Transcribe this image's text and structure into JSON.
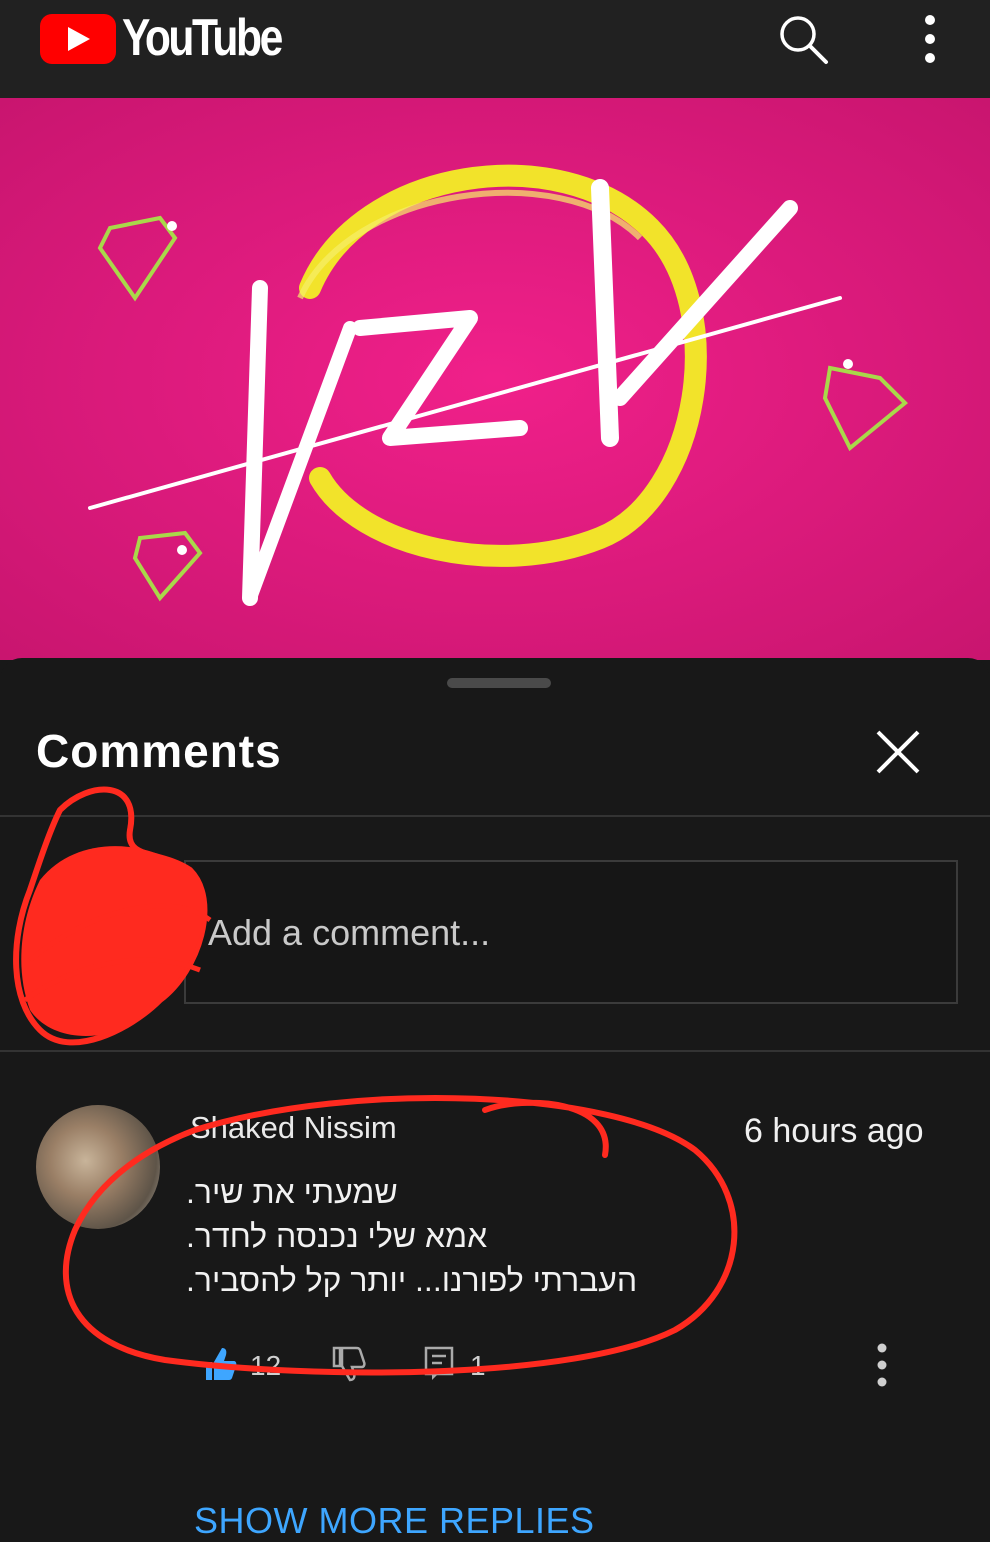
{
  "app": {
    "brand": "YouTube",
    "colors": {
      "brand_red": "#ff0000",
      "accent_blue": "#3ea6ff",
      "background": "#181818",
      "topbar": "#212121"
    }
  },
  "header": {
    "search_icon": "search-icon",
    "menu_icon": "more-vertical-icon"
  },
  "video": {
    "thumbnail_colors": {
      "background": "#e8177f",
      "ring": "#f2e32a",
      "lettering": "#ffffff",
      "gems": "#a9d84a"
    }
  },
  "comments": {
    "title": "Comments",
    "close_icon": "close-icon",
    "input_placeholder": "Add a comment...",
    "items": [
      {
        "author": "Shaked Nissim",
        "time": "6 hours ago",
        "lines": [
          "שמעתי את שיר.",
          "אמא שלי נכנסה לחדר.",
          "העברתי לפורנו... יותר קל להסביר."
        ],
        "likes": "12",
        "replies": "1"
      }
    ],
    "show_more": "SHOW MORE REPLIES"
  }
}
